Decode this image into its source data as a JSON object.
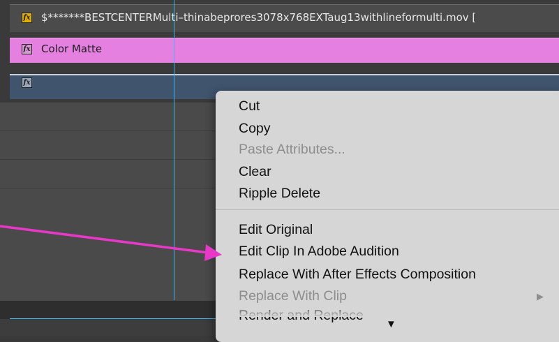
{
  "tracks": {
    "fx_badge": "fx",
    "top_clip_name": "$*******BESTCENTERMulti–thinabeprores3078x768EXTaug13withlineformulti.mov [",
    "matte_clip_name": "Color Matte"
  },
  "colors": {
    "matte_clip": "#e57fe0",
    "blue_clip": "#41546e",
    "playhead": "#39b5ef",
    "annotation_arrow": "#e838c8"
  },
  "context_menu": {
    "items": [
      {
        "label": "Cut",
        "enabled": true
      },
      {
        "label": "Copy",
        "enabled": true
      },
      {
        "label": "Paste Attributes...",
        "enabled": false
      },
      {
        "label": "Clear",
        "enabled": true
      },
      {
        "label": "Ripple Delete",
        "enabled": true
      },
      {
        "label": "Edit Original",
        "enabled": true
      },
      {
        "label": "Edit Clip In Adobe Audition",
        "enabled": true
      },
      {
        "label": "Replace With After Effects Composition",
        "enabled": true
      },
      {
        "label": "Replace With Clip",
        "enabled": false,
        "submenu": true
      },
      {
        "label": "Render and Replace",
        "enabled": true
      }
    ],
    "submenu_arrow": "▶",
    "scroll_down_arrow": "▼"
  }
}
